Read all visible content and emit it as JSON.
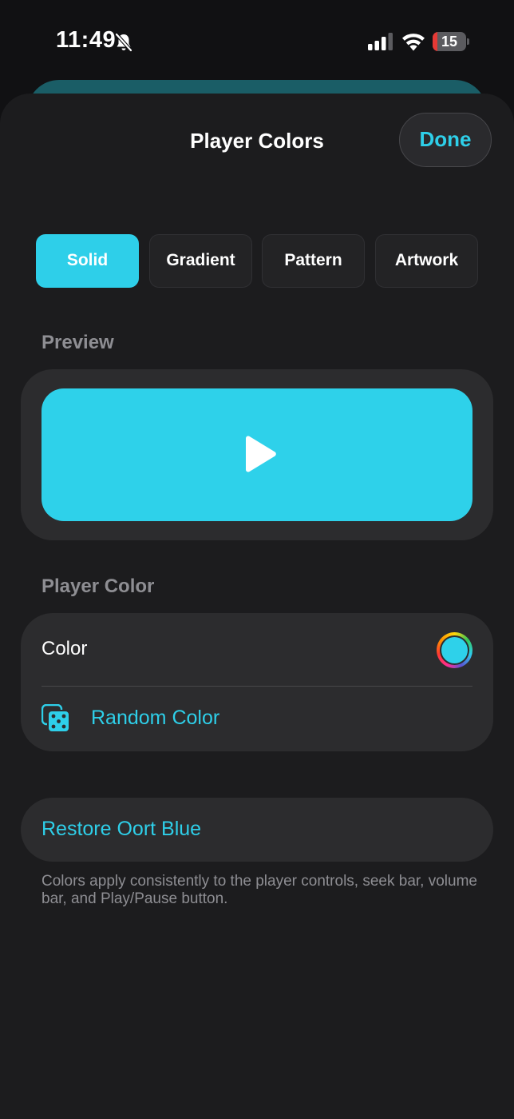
{
  "status_bar": {
    "time": "11:49",
    "battery_level": "15",
    "battery_fraction": 0.15
  },
  "sheet": {
    "title": "Player Colors",
    "done_label": "Done"
  },
  "style_tabs": [
    {
      "label": "Solid",
      "selected": true
    },
    {
      "label": "Gradient",
      "selected": false
    },
    {
      "label": "Pattern",
      "selected": false
    },
    {
      "label": "Artwork",
      "selected": false
    }
  ],
  "preview": {
    "section_label": "Preview",
    "player_color": "#2ed1ea",
    "icon": "play-icon"
  },
  "player_color": {
    "section_label": "Player Color",
    "color_label": "Color",
    "current_color": "#2ed1ea",
    "random_label": "Random Color",
    "random_icon": "dice-icon"
  },
  "restore": {
    "label": "Restore Oort Blue"
  },
  "footnote": "Colors apply consistently to the player controls, seek bar, volume bar, and Play/Pause button.",
  "colors": {
    "accent": "#2ecfe9",
    "sheet_background": "#1c1c1e",
    "card_background": "#2c2c2e",
    "secondary_text": "#8e8e93"
  }
}
